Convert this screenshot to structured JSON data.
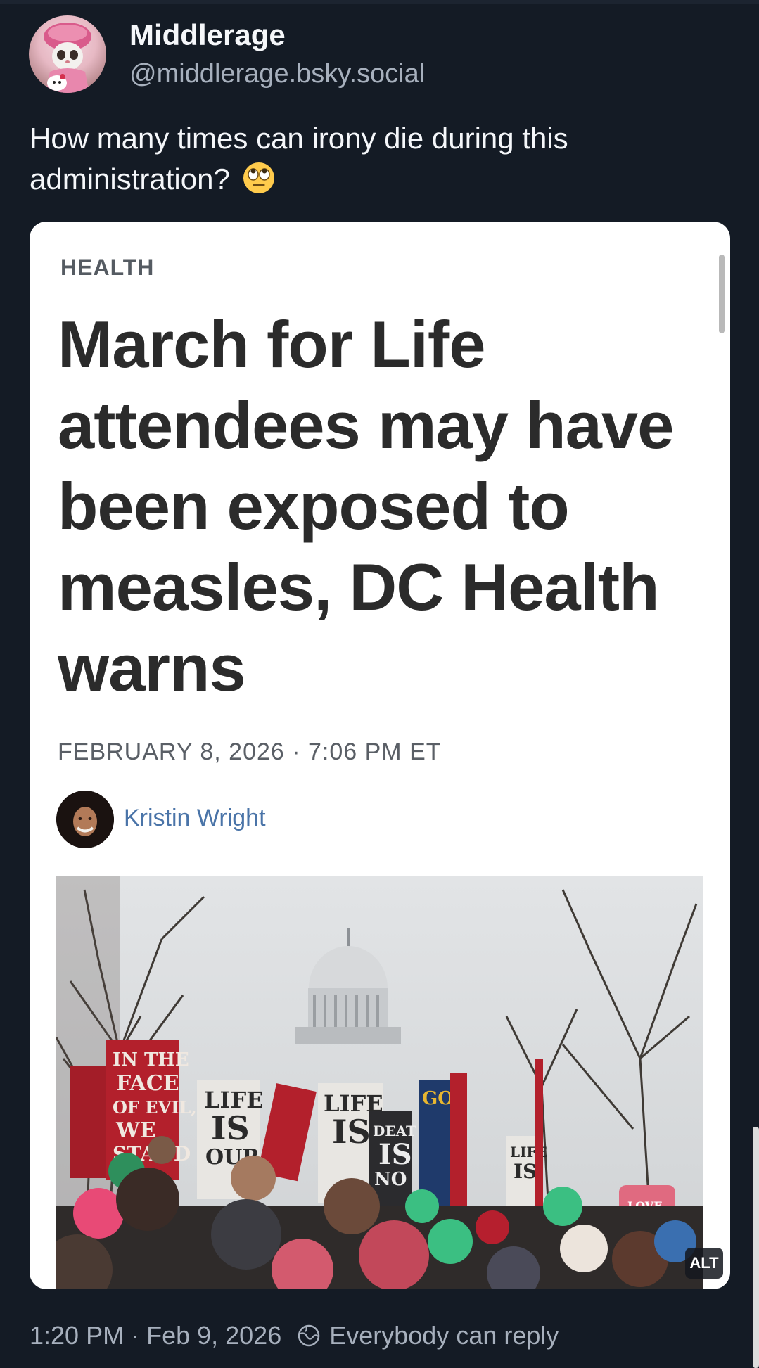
{
  "post": {
    "display_name": "Middlerage",
    "handle": "@middlerage.bsky.social",
    "text": "How many times can irony die during this administration?",
    "emoji": "eye-roll-emoji",
    "time": "1:20 PM",
    "separator": "·",
    "date": "Feb 9, 2026",
    "reply_setting": "Everybody can reply"
  },
  "article": {
    "kicker": "HEALTH",
    "headline": "March for Life attendees may have been exposed to measles, DC Health warns",
    "dateline": "FEBRUARY 8, 2026 · 7:06 PM ET",
    "author": "Kristin Wright",
    "alt_badge": "ALT",
    "photo_signs": [
      "IN THE FACE OF EVIL, WE STAND",
      "LIFE IS OUR",
      "GO",
      "DEAT IS NO",
      "LOVE BOTH"
    ]
  },
  "colors": {
    "background": "#141b25",
    "text_primary": "#f5f7fa",
    "text_secondary": "#a7b0bd",
    "author_link": "#4a74a8"
  }
}
